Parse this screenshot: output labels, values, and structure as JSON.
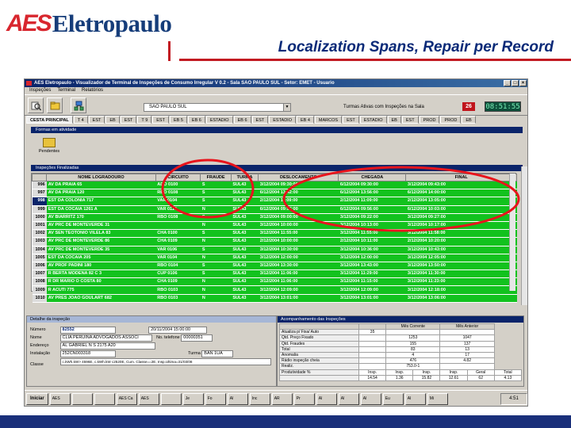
{
  "slide": {
    "title": "Localization Spans, Repair per Record",
    "logo": {
      "aes": "AES",
      "word": "Eletropaulo"
    },
    "colors": {
      "brand_red": "#d8262e",
      "brand_blue": "#0a2a78",
      "row_green": "#12c21e",
      "ellipse_red": "#e8141c"
    }
  },
  "app": {
    "window_title": "AES Eletropaulo - Visualizador de Terminal de Inspeções de Consumo Irregular V 0.2 - Sala SAO PAULO SUL - Setor: EMET - Usuario",
    "menu": [
      "Inspeções",
      "Terminal",
      "Relatórios"
    ],
    "combo_value": "SAO PAULO SUL",
    "turmas_label": "Turmas Ativas com Inspeções na Sala",
    "turmas_count": "26",
    "clock": "08:51:55",
    "tabs": [
      "CESTA PRINCIPAL",
      "T 4",
      "EST",
      "EB",
      "EST",
      "T 9",
      "EST",
      "EB 5",
      "EB 6",
      "ESTADIO",
      "EB 6",
      "EST",
      "ESTADIO",
      "EB 4",
      "MARCOS",
      "EST",
      "ESTADIO",
      "EB",
      "EST",
      "PROD",
      "PROD",
      "EB"
    ],
    "forms_bar": "Formas em atividade",
    "pending_label": "Pendentes",
    "grid_bar": "Inspeções Finalizadas",
    "grid": {
      "headers": [
        "",
        "NOME LOGRADOURO",
        "CIRCUITO",
        "FRAUDE",
        "TURMA",
        "DESLOCAMENTO",
        "CHEGADA",
        "FINAL"
      ],
      "rows": [
        [
          "996",
          "AV DA PRAIA 65",
          "ADO 0100",
          "S",
          "SUL43",
          "3/12/2004 09:30:00",
          "6/12/2004 09:30:00",
          "3/12/2004 09:43:00"
        ],
        [
          "997",
          "AV DA PRAIA 120",
          "RBO 0108",
          "S",
          "SUL43",
          "6/12/2004 13:42:00",
          "6/12/2004 13:56:00",
          "6/12/2004 14:00:00"
        ],
        [
          "998",
          "EST DA COLONIA 717",
          "VAR 0104",
          "S",
          "SUL43",
          "2/12/2004 11:09:00",
          "2/12/2004 11:09:00",
          "2/12/2004 13:05:00"
        ],
        [
          "999",
          "EST DA COCAIA 1261 A",
          "VAR 0110",
          "N",
          "SUL43",
          "6/12/2004 09:56:00",
          "6/12/2004 09:56:00",
          "6/12/2004 10:03:00"
        ],
        [
          "1000",
          "AV BIARRITZ 170",
          "RBO 0108",
          "S",
          "SUL43",
          "3/12/2004 09:00:00",
          "3/12/2004 09:22:00",
          "3/12/2004 09:27:00"
        ],
        [
          "1001",
          "AV PRC DE MONTEVERDE 31",
          "",
          "N",
          "SUL43",
          "3/12/2004 10:00:00",
          "3/12/2004 10:13:00",
          "3/12/2004 10:17:00"
        ],
        [
          "1002",
          "AV SEN TEOTONIO VILELA 83",
          "CHA 0100",
          "S",
          "SUL43",
          "3/12/2004 11:55:00",
          "3/12/2004 11:55:00",
          "3/12/2004 11:58:00"
        ],
        [
          "1003",
          "AV PRC DE MONTEVERDE 86",
          "CHA 0109",
          "N",
          "SUL43",
          "2/12/2004 10:00:00",
          "2/12/2004 10:11:00",
          "2/12/2004 10:20:00"
        ],
        [
          "1004",
          "AV PRC DE MONTEVERDE 35",
          "VAR 0106",
          "S",
          "SUL43",
          "3/12/2004 10:30:00",
          "3/12/2004 10:36:00",
          "3/12/2004 10:43:00"
        ],
        [
          "1005",
          "EST DA COCAIA 205",
          "VAR 0104",
          "N",
          "SUL43",
          "3/12/2004 12:00:00",
          "3/12/2004 12:00:00",
          "3/12/2004 12:05:00"
        ],
        [
          "1006",
          "AV PROF PADINI 180",
          "RBO 0104",
          "S",
          "SUL43",
          "3/12/2004 13:30:00",
          "3/12/2004 13:43:00",
          "3/12/2004 13:50:00"
        ],
        [
          "1007",
          "R BERTA MODENA 82 C 3",
          "CUP 0106",
          "S",
          "SUL43",
          "3/12/2004 11:06:00",
          "3/12/2004 11:29:00",
          "3/12/2004 11:30:00"
        ],
        [
          "1008",
          "R DR MARIO O COSTA 80",
          "CHA 0109",
          "N",
          "SUL43",
          "3/12/2004 11:06:00",
          "3/12/2004 11:15:00",
          "3/12/2004 11:23:00"
        ],
        [
          "1009",
          "R ACUTI 775",
          "RBO 0103",
          "N",
          "SUL43",
          "3/12/2004 12:09:00",
          "3/12/2004 12:09:00",
          "3/12/2004 12:18:00"
        ],
        [
          "1010",
          "AV PRES JOAO GOULART 682",
          "RBO 0103",
          "N",
          "SUL43",
          "3/12/2004 13:01:00",
          "3/12/2004 13:01:00",
          "3/12/2004 13:06:00"
        ]
      ]
    },
    "detail": {
      "header": "Detalhe da inspeção",
      "numero_label": "Número",
      "numero": "82552",
      "data": "20/11/2004 15:00:00",
      "nome_label": "Nome",
      "nome": "CLIA PERUINA ADVOGADOS ASSOCI",
      "telefone_label": "No. telefone",
      "telefone": "00000351",
      "endereco_label": "Endereço",
      "endereco": "AL GABRIEL N S 2175 A20",
      "instalacao_label": "Instalação",
      "instalacao": "252CN003318",
      "turma_label": "Turma",
      "turma": "BAN 1UA",
      "classe_label": "Classe",
      "classe": "c.kWh.kW> 4596E, c.kWh.kW c2520E, Cum. Classe==2E, Insp.Ultima=31/03/08"
    },
    "accomp": {
      "header": "Acompanhamento das Inspeções",
      "headers": [
        "",
        "",
        "Mês Corrente",
        "Mês Anterior"
      ],
      "rows": [
        [
          "Atualiza p/ Fixa/ Auto",
          "35",
          "",
          ""
        ],
        [
          "Qtd. Preço Fixado",
          "",
          "1253",
          "1047"
        ],
        [
          "Qtd. Fraudes",
          "",
          "155",
          "137"
        ],
        [
          "Total",
          "",
          "83",
          "13"
        ],
        [
          "Anomalia",
          "",
          "4",
          "17"
        ],
        [
          "Rádio inspeção cheia",
          "",
          "476",
          "4.82"
        ],
        [
          "Realiz.",
          "",
          "753.0-1",
          ""
        ],
        [
          "Produtividade %",
          "Insp.",
          "Insp.",
          "Insp.",
          "Insp.",
          "Geral",
          "Total"
        ],
        [
          "",
          "14.54",
          "1.36",
          "15.82",
          "12.61",
          "62",
          "4.13"
        ]
      ]
    },
    "taskbar": {
      "start": "Iniciar",
      "tasks": [
        "AES",
        "",
        "",
        "AES Ca",
        "AES",
        "",
        "Je",
        "Fo",
        "Al",
        "Inc",
        "AR",
        "Pr",
        "Al",
        "Al",
        "Al",
        "Eu",
        "Al",
        "Mi"
      ],
      "clock": "4:51"
    }
  }
}
